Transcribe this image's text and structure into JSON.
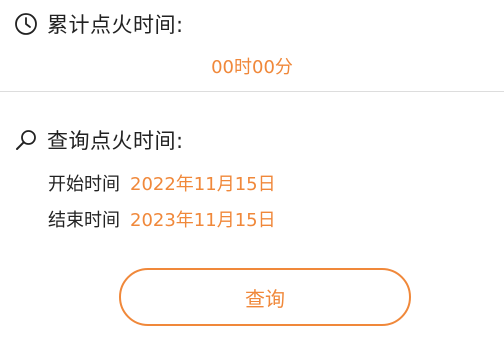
{
  "total": {
    "icon": "clock-icon",
    "title": "累计点火时间:",
    "value": "00时00分"
  },
  "query": {
    "icon": "search-icon",
    "title": "查询点火时间:",
    "start_label": "开始时间",
    "start_value": "2022年11月15日",
    "end_label": "结束时间",
    "end_value": "2023年11月15日",
    "button_label": "查询"
  },
  "colors": {
    "accent": "#f0883a",
    "text": "#222222",
    "divider": "#dddddd"
  }
}
